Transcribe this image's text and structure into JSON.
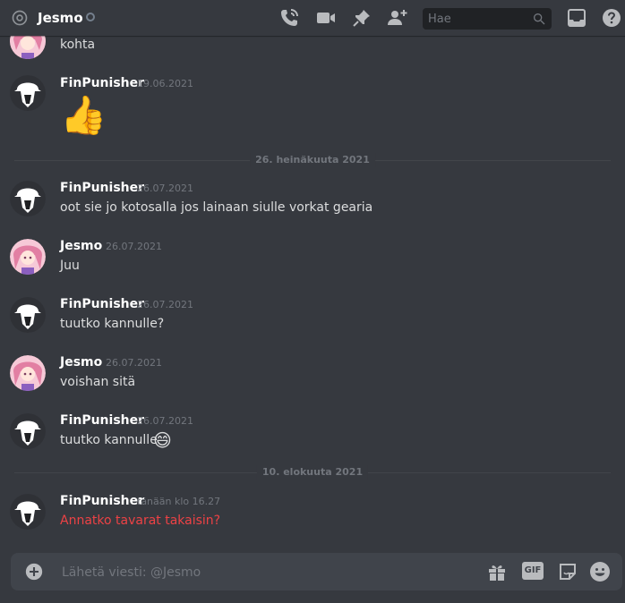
{
  "header": {
    "channel_name": "Jesmo",
    "search_placeholder": "Hae"
  },
  "messages": [
    {
      "text": "kohta"
    },
    {
      "author": "FinPunisher",
      "timestamp": "19.06.2021",
      "emoji": "👍"
    },
    {
      "divider": "26. heinäkuuta 2021"
    },
    {
      "author": "FinPunisher",
      "timestamp": "26.07.2021",
      "text": "oot sie jo kotosalla jos lainaan siulle vorkat gearia"
    },
    {
      "author": "Jesmo",
      "timestamp": "26.07.2021",
      "text": "Juu"
    },
    {
      "author": "FinPunisher",
      "timestamp": "26.07.2021",
      "text": "tuutko kannulle?"
    },
    {
      "author": "Jesmo",
      "timestamp": "26.07.2021",
      "text": "voishan sitä"
    },
    {
      "author": "FinPunisher",
      "timestamp": "26.07.2021",
      "text": "tuutko kannulle",
      "emoji": "😄"
    },
    {
      "divider": "10. elokuuta 2021"
    },
    {
      "author": "FinPunisher",
      "timestamp": "tänään klo 16.27",
      "text": "Annatko tavarat takaisin?"
    }
  ],
  "composer": {
    "placeholder": "Lähetä viesti: @Jesmo",
    "gif_label": "GIF"
  },
  "colors": {
    "background": "#36393f",
    "mention_text": "#ed4245",
    "muted": "#72767d"
  }
}
